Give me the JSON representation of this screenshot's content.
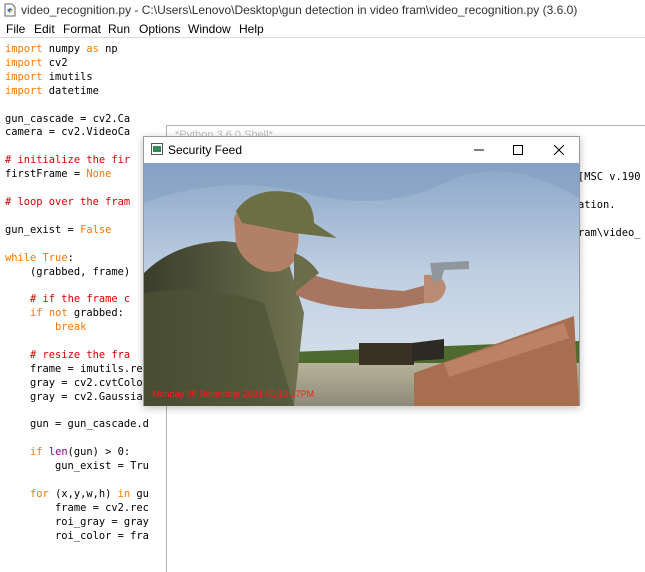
{
  "window": {
    "title": "video_recognition.py - C:\\Users\\Lenovo\\Desktop\\gun detection in video fram\\video_recognition.py (3.6.0)"
  },
  "menu": [
    "File",
    "Edit",
    "Format",
    "Run",
    "Options",
    "Window",
    "Help"
  ],
  "code_lines": [
    "import numpy as np",
    "import cv2",
    "import imutils",
    "import datetime",
    "",
    "gun_cascade = cv2.Ca",
    "camera = cv2.VideoCa",
    "",
    "# initialize the fir",
    "firstFrame = None",
    "",
    "# loop over the fram",
    "",
    "gun_exist = False",
    "",
    "while True:",
    "    (grabbed, frame)",
    "",
    "    # if the frame c",
    "    if not grabbed:",
    "        break",
    "",
    "    # resize the fra",
    "    frame = imutils.res",
    "    gray = cv2.cvtColor",
    "    gray = cv2.Gaussian",
    "",
    "    gun = gun_cascade.d",
    "",
    "    if len(gun) > 0:",
    "        gun_exist = Tru",
    "",
    "    for (x,y,w,h) in gu",
    "        frame = cv2.rec",
    "        roi_gray = gray",
    "        roi_color = fra"
  ],
  "shell": {
    "title": "*Python 3.6.0 Shell*",
    "lines": [
      "[MSC v.190",
      "ation.",
      "ram\\video_"
    ]
  },
  "feed": {
    "title": "Security Feed",
    "timestamp": "Monday 08 November 2021 05:12:17PM"
  }
}
